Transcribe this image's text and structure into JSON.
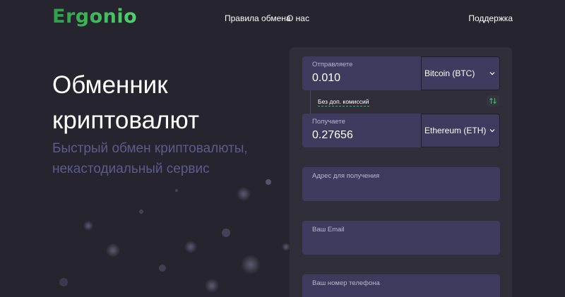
{
  "header": {
    "logo": "Ergonio",
    "nav": {
      "exchange_rules": "Правила обмена",
      "about": "О нас",
      "support": "Поддержка"
    }
  },
  "hero": {
    "title": "Обменник криптовалют",
    "subtitle": "Быстрый обмен криптовалюты, некастодиальный сервис"
  },
  "form": {
    "send": {
      "label": "Отправляете",
      "amount": "0.010",
      "currency": "Bitcoin (BTC)"
    },
    "commission_note": "Без доп. комиссий",
    "receive": {
      "label": "Получаете",
      "amount": "0.27656",
      "currency": "Ethereum (ETH)"
    },
    "address_placeholder": "Адрес для получения",
    "email_placeholder": "Ваш Email",
    "phone_placeholder": "Ваш номер телефона"
  },
  "colors": {
    "background": "#26252f",
    "panel": "#2f2e39",
    "field": "#3f3b5e",
    "accent_green": "#39b55a",
    "subtitle": "#5e5a8a"
  },
  "icons": {
    "swap": "swap-arrows-icon",
    "dropdown": "chevron-down-icon"
  }
}
